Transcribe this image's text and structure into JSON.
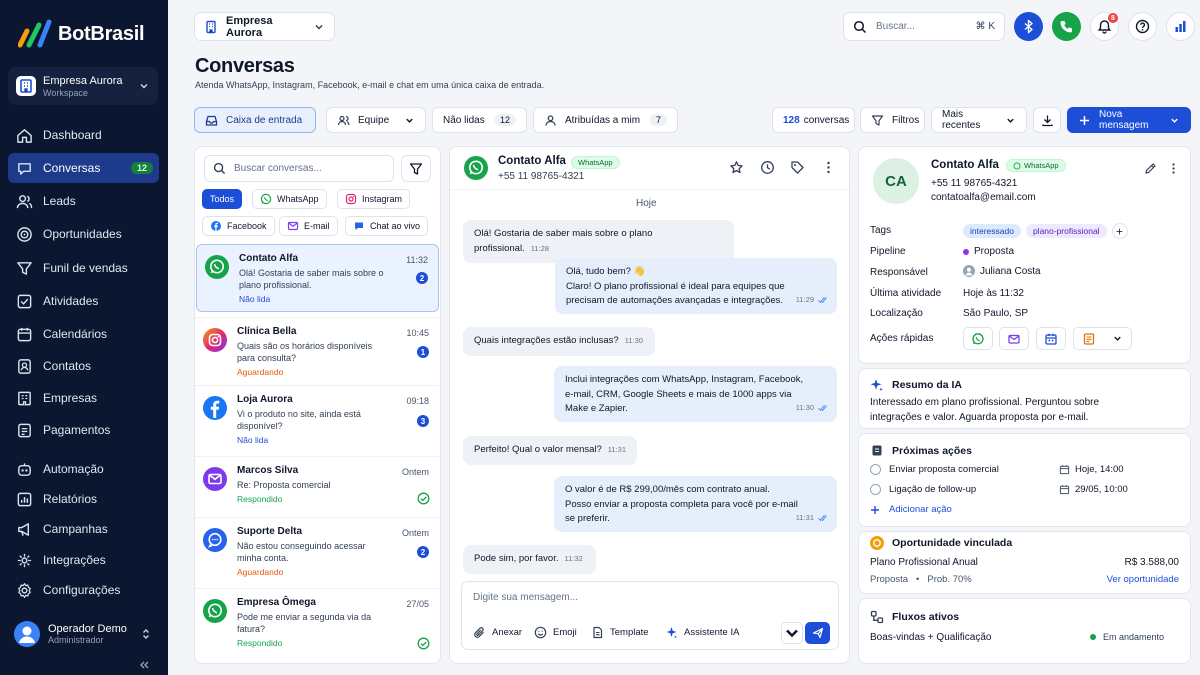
{
  "app": {
    "name": "BotBrasil"
  },
  "workspace": {
    "name": "Empresa Aurora",
    "role": "Workspace"
  },
  "nav": [
    {
      "label": "Dashboard",
      "icon": "dashboard-icon"
    },
    {
      "label": "Conversas",
      "icon": "chat-icon",
      "badge": "12",
      "active": true
    },
    {
      "label": "Leads",
      "icon": "users-icon"
    },
    {
      "label": "Oportunidades",
      "icon": "target-icon"
    },
    {
      "label": "Funil de vendas",
      "icon": "funnel-icon"
    },
    {
      "label": "Atividades",
      "icon": "checklist-icon"
    },
    {
      "label": "Calendários",
      "icon": "calendar-icon"
    },
    {
      "label": "Contatos",
      "icon": "contacts-icon"
    },
    {
      "label": "Empresas",
      "icon": "building-icon"
    },
    {
      "label": "Pagamentos",
      "icon": "payment-icon"
    },
    {
      "label": "Automação",
      "icon": "automation-icon"
    },
    {
      "label": "Relatórios",
      "icon": "reports-icon"
    },
    {
      "label": "Campanhas",
      "icon": "megaphone-icon"
    },
    {
      "label": "Integrações",
      "icon": "integrations-icon"
    },
    {
      "label": "Configurações",
      "icon": "settings-icon"
    }
  ],
  "user": {
    "name": "Operador Demo",
    "role": "Administrador"
  },
  "topbar": {
    "company": "Empresa Aurora",
    "search_placeholder": "Buscar...",
    "search_shortcut": "⌘ K",
    "notification_count": "8"
  },
  "header": {
    "title": "Conversas",
    "subtitle": "Atenda WhatsApp, Instagram, Facebook, e-mail e chat em uma única caixa de entrada."
  },
  "filters": {
    "inbox": "Caixa de entrada",
    "team": "Equipe",
    "unread": "Não lidas",
    "unread_count": "12",
    "assigned": "Atribuídas a mim",
    "assigned_count": "7",
    "total_count": "128",
    "total_label": "conversas",
    "filters": "Filtros",
    "sort": "Mais recentes",
    "new_message": "Nova mensagem"
  },
  "list": {
    "search_placeholder": "Buscar conversas...",
    "channels": [
      "Todos",
      "WhatsApp",
      "Instagram",
      "Facebook",
      "E-mail",
      "Chat ao vivo"
    ],
    "conversations": [
      {
        "name": "Contato Alfa",
        "time": "11:32",
        "message": "Olá! Gostaria de saber mais sobre o plano profissional.",
        "status": "Não lida",
        "unread": "2",
        "channel": "whatsapp"
      },
      {
        "name": "Clínica Bella",
        "time": "10:45",
        "message": "Quais são os horários disponíveis para consulta?",
        "status": "Aguardando",
        "unread": "1",
        "channel": "instagram"
      },
      {
        "name": "Loja Aurora",
        "time": "09:18",
        "message": "Vi o produto no site, ainda está disponível?",
        "status": "Não lida",
        "unread": "3",
        "channel": "facebook"
      },
      {
        "name": "Marcos Silva",
        "time": "Ontem",
        "message": "Re: Proposta comercial",
        "status": "Respondido",
        "channel": "email"
      },
      {
        "name": "Suporte Delta",
        "time": "Ontem",
        "message": "Não estou conseguindo acessar minha conta.",
        "status": "Aguardando",
        "unread": "2",
        "channel": "chat"
      },
      {
        "name": "Empresa Ômega",
        "time": "27/05",
        "message": "Pode me enviar a segunda via da fatura?",
        "status": "Respondido",
        "channel": "whatsapp"
      }
    ]
  },
  "chat": {
    "contact": "Contato Alfa",
    "channel": "WhatsApp",
    "phone": "+55 11 98765-4321",
    "day": "Hoje",
    "messages": [
      {
        "dir": "in",
        "text": "Olá! Gostaria de saber mais sobre o plano profissional.",
        "time": "11:28"
      },
      {
        "dir": "out",
        "lines": [
          "Olá, tudo bem? 👋",
          "Claro! O plano profissional é ideal para equipes que",
          "precisam de automações avançadas e integrações."
        ],
        "time": "11:29"
      },
      {
        "dir": "in",
        "text": "Quais integrações estão inclusas?",
        "time": "11:30"
      },
      {
        "dir": "out",
        "lines": [
          "Inclui integrações com WhatsApp, Instagram, Facebook,",
          "e-mail, CRM, Google Sheets e mais de 1000 apps via",
          "Make e Zapier."
        ],
        "time": "11:30"
      },
      {
        "dir": "in",
        "text": "Perfeito! Qual o valor mensal?",
        "time": "11:31"
      },
      {
        "dir": "out",
        "lines": [
          "O valor é de R$ 299,00/mês com contrato anual.",
          "Posso enviar a proposta completa para você por e-mail",
          "se preferir."
        ],
        "time": "11:31"
      },
      {
        "dir": "in",
        "text": "Pode sim, por favor.",
        "time": "11:32"
      }
    ],
    "compose_placeholder": "Digite sua mensagem...",
    "tools": [
      "Anexar",
      "Emoji",
      "Template",
      "Assistente IA"
    ]
  },
  "contact": {
    "initials": "CA",
    "name": "Contato Alfa",
    "channel": "WhatsApp",
    "phone": "+55 11 98765-4321",
    "email": "contatoalfa@email.com",
    "labels": {
      "tags": "Tags",
      "pipeline": "Pipeline",
      "owner": "Responsável",
      "last_activity": "Última atividade",
      "location": "Localização",
      "quick_actions": "Ações rápidas"
    },
    "tags": [
      "interessado",
      "plano-profissional"
    ],
    "pipeline": "Proposta",
    "owner": "Juliana Costa",
    "last_activity": "Hoje às 11:32",
    "location": "São Paulo, SP"
  },
  "ai": {
    "title": "Resumo da IA",
    "text": "Interessado em plano profissional. Perguntou sobre integrações e valor. Aguarda proposta por e-mail."
  },
  "next_actions": {
    "title": "Próximas ações",
    "items": [
      {
        "label": "Enviar proposta comercial",
        "when": "Hoje, 14:00"
      },
      {
        "label": "Ligação de follow-up",
        "when": "29/05, 10:00"
      }
    ],
    "add": "Adicionar ação"
  },
  "opportunity": {
    "title": "Oportunidade vinculada",
    "name": "Plano Profissional Anual",
    "value": "R$ 3.588,00",
    "stage": "Proposta",
    "prob": "Prob. 70%",
    "link": "Ver oportunidade"
  },
  "flows": {
    "title": "Fluxos ativos",
    "name": "Boas-vindas + Qualificação",
    "status": "Em andamento"
  },
  "colors": {
    "primary": "#1d4ed8",
    "sidebar": "#0b1630",
    "whatsapp": "#16a34a",
    "instagram": "#db2777",
    "facebook": "#1877f2",
    "email": "#7c3aed",
    "chat": "#2563eb",
    "unread": "#1d4ed8",
    "waiting": "#ea580c",
    "answered": "#16a34a"
  }
}
